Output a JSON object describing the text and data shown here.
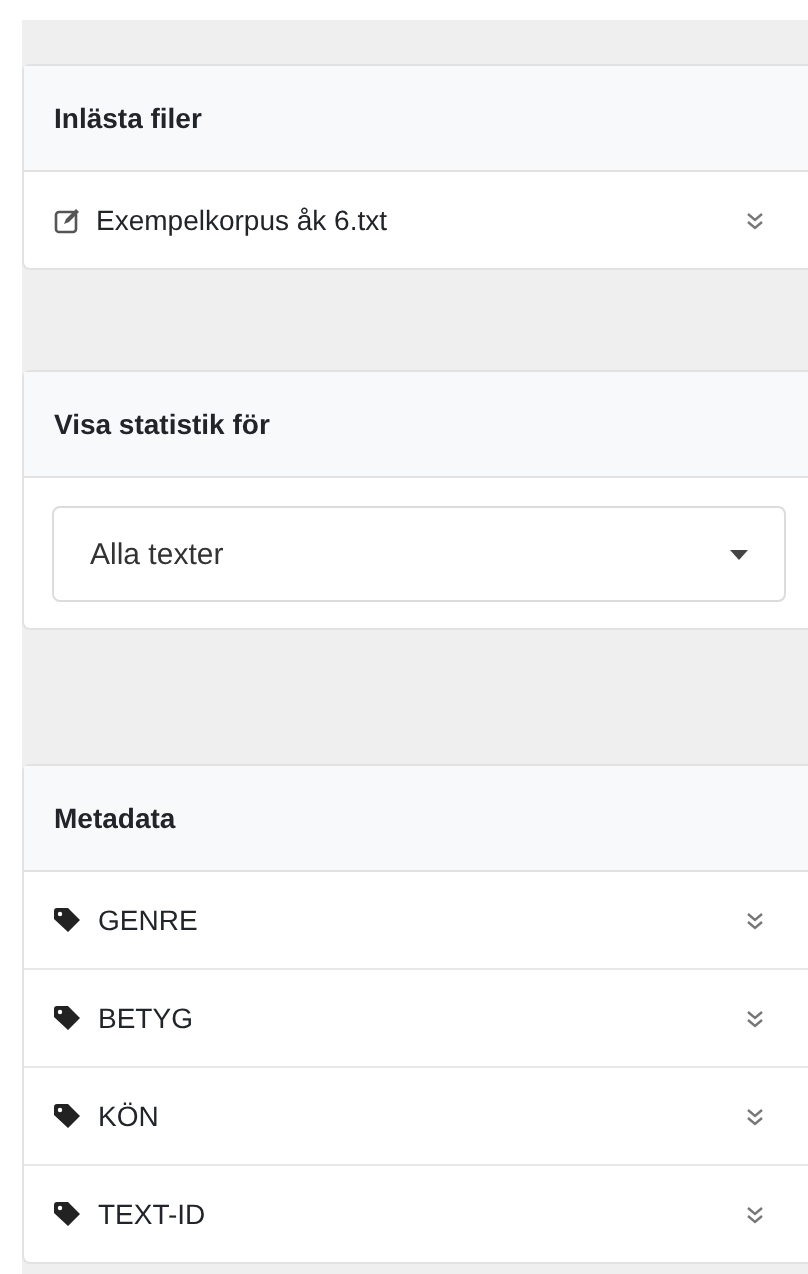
{
  "files_panel": {
    "title": "Inlästa filer",
    "items": [
      {
        "label": "Exempelkorpus åk 6.txt"
      }
    ]
  },
  "stats_panel": {
    "title": "Visa statistik för",
    "select": {
      "value": "Alla texter"
    }
  },
  "metadata_panel": {
    "title": "Metadata",
    "items": [
      {
        "label": "GENRE"
      },
      {
        "label": "BETYG"
      },
      {
        "label": "KÖN"
      },
      {
        "label": "TEXT-ID"
      }
    ]
  }
}
